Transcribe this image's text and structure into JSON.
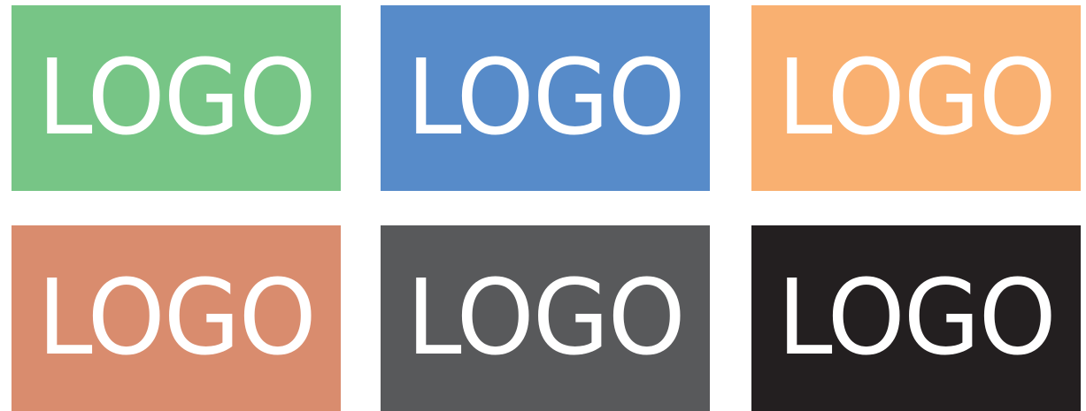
{
  "tiles": [
    {
      "label": "LOGO",
      "color": "#77c586"
    },
    {
      "label": "LOGO",
      "color": "#578bc9"
    },
    {
      "label": "LOGO",
      "color": "#f9b071"
    },
    {
      "label": "LOGO",
      "color": "#d98c6e"
    },
    {
      "label": "LOGO",
      "color": "#58595b"
    },
    {
      "label": "LOGO",
      "color": "#231f20"
    }
  ]
}
